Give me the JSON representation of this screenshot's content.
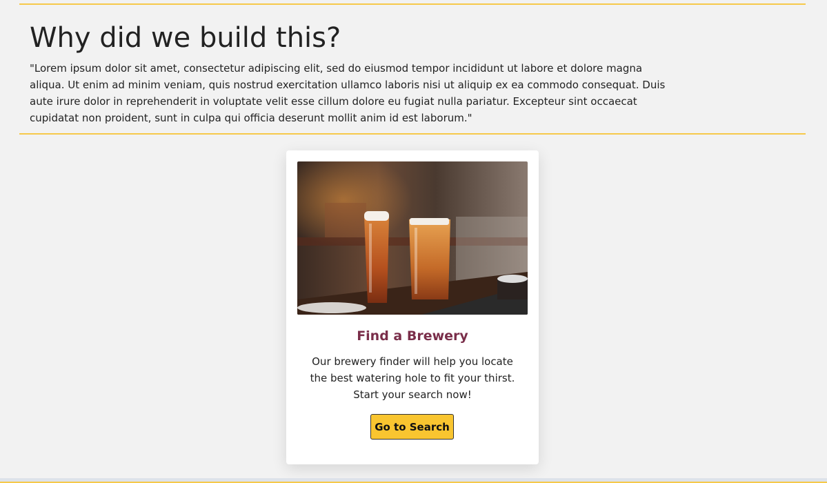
{
  "about": {
    "heading": "Why did we build this?",
    "body": "\"Lorem ipsum dolor sit amet, consectetur adipiscing elit, sed do eiusmod tempor incididunt ut labore et dolore magna aliqua. Ut enim ad minim veniam, quis nostrud exercitation ullamco laboris nisi ut aliquip ex ea commodo consequat. Duis aute irure dolor in reprehenderit in voluptate velit esse cillum dolore eu fugiat nulla pariatur. Excepteur sint occaecat cupidatat non proident, sunt in culpa qui officia deserunt mollit anim id est laborum.\""
  },
  "card": {
    "image_icon": "beer-glasses-photo",
    "title": "Find a Brewery",
    "text": "Our brewery finder will help you locate the best watering hole to fit your thirst. Start your search now!",
    "button_label": "Go to Search"
  },
  "colors": {
    "accent": "#f6c94a",
    "button": "#f9c530",
    "title": "#7a2e4a",
    "background": "#f2f2f2"
  }
}
